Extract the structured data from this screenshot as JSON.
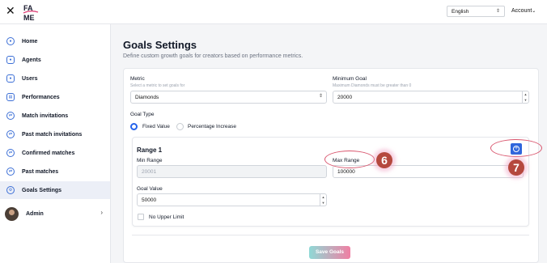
{
  "topbar": {
    "logo_text": "FA ME",
    "language": "English",
    "account_label": "Account"
  },
  "sidebar": {
    "items": [
      {
        "label": "Home",
        "icon": "home-icon"
      },
      {
        "label": "Agents",
        "icon": "user-icon"
      },
      {
        "label": "Users",
        "icon": "user-icon"
      },
      {
        "label": "Performances",
        "icon": "chart-icon"
      },
      {
        "label": "Match invitations",
        "icon": "swap-icon"
      },
      {
        "label": "Past match invitations",
        "icon": "swap-icon"
      },
      {
        "label": "Confirmed matches",
        "icon": "swap-icon"
      },
      {
        "label": "Past matches",
        "icon": "swap-icon"
      },
      {
        "label": "Goals Settings",
        "icon": "gear-icon",
        "active": true
      }
    ],
    "user": {
      "name": "Admin"
    }
  },
  "page": {
    "title": "Goals Settings",
    "subtitle": "Define custom growth goals for creators based on performance metrics."
  },
  "form": {
    "metric_label": "Metric",
    "metric_hint": "Select a metric to set goals for",
    "metric_value": "Diamonds",
    "min_goal_label": "Minimum Goal",
    "min_goal_hint": "Maximum Diamonds must be greater than 0",
    "min_goal_value": "20000",
    "goal_type_label": "Goal Type",
    "goal_type_options": [
      "Fixed Value",
      "Percentage Increase"
    ],
    "goal_type_selected": "Fixed Value",
    "range": {
      "title": "Range 1",
      "min_range_label": "Min Range",
      "min_range_value": "20001",
      "max_range_label": "Max Range",
      "max_range_value": "100000",
      "goal_value_label": "Goal Value",
      "goal_value": "50000",
      "no_upper_limit_label": "No Upper Limit"
    },
    "save_label": "Save Goals"
  },
  "annotations": {
    "step_6": "6",
    "step_7": "7"
  },
  "colors": {
    "accent": "#2f66dc",
    "annotation": "#b5483e",
    "save_gradient_start": "#8fd9d6",
    "save_gradient_end": "#f07fa3"
  }
}
